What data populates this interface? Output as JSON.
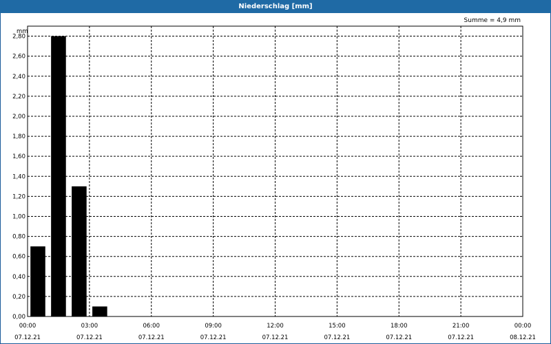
{
  "window": {
    "title": "Niederschlag [mm]"
  },
  "summary": {
    "text": "Summe = 4,9 mm"
  },
  "colors": {
    "titlebar": "#1f6aa5",
    "bar": "#000000",
    "grid": "#000000"
  },
  "chart_data": {
    "type": "bar",
    "title": "Niederschlag [mm]",
    "ylabel": "mm",
    "xlabel": "",
    "ylim": [
      0,
      2.9
    ],
    "yticks": [
      "0,00",
      "0,20",
      "0,40",
      "0,60",
      "0,80",
      "1,00",
      "1,20",
      "1,40",
      "1,60",
      "1,80",
      "2,00",
      "2,20",
      "2,40",
      "2,60",
      "2,80"
    ],
    "ytick_values": [
      0,
      0.2,
      0.4,
      0.6,
      0.8,
      1.0,
      1.2,
      1.4,
      1.6,
      1.8,
      2.0,
      2.2,
      2.4,
      2.6,
      2.8
    ],
    "xlim_hours": [
      0,
      24
    ],
    "xticks": [
      {
        "time": "00:00",
        "date": "07.12.21"
      },
      {
        "time": "03:00",
        "date": "07.12.21"
      },
      {
        "time": "06:00",
        "date": "07.12.21"
      },
      {
        "time": "09:00",
        "date": "07.12.21"
      },
      {
        "time": "12:00",
        "date": "07.12.21"
      },
      {
        "time": "15:00",
        "date": "07.12.21"
      },
      {
        "time": "18:00",
        "date": "07.12.21"
      },
      {
        "time": "21:00",
        "date": "07.12.21"
      },
      {
        "time": "00:00",
        "date": "08.12.21"
      }
    ],
    "categories": [
      "00:00-01:00",
      "01:00-02:00",
      "02:00-03:00",
      "03:00-04:00"
    ],
    "values": [
      0.7,
      2.8,
      1.3,
      0.1
    ],
    "grid": true
  }
}
